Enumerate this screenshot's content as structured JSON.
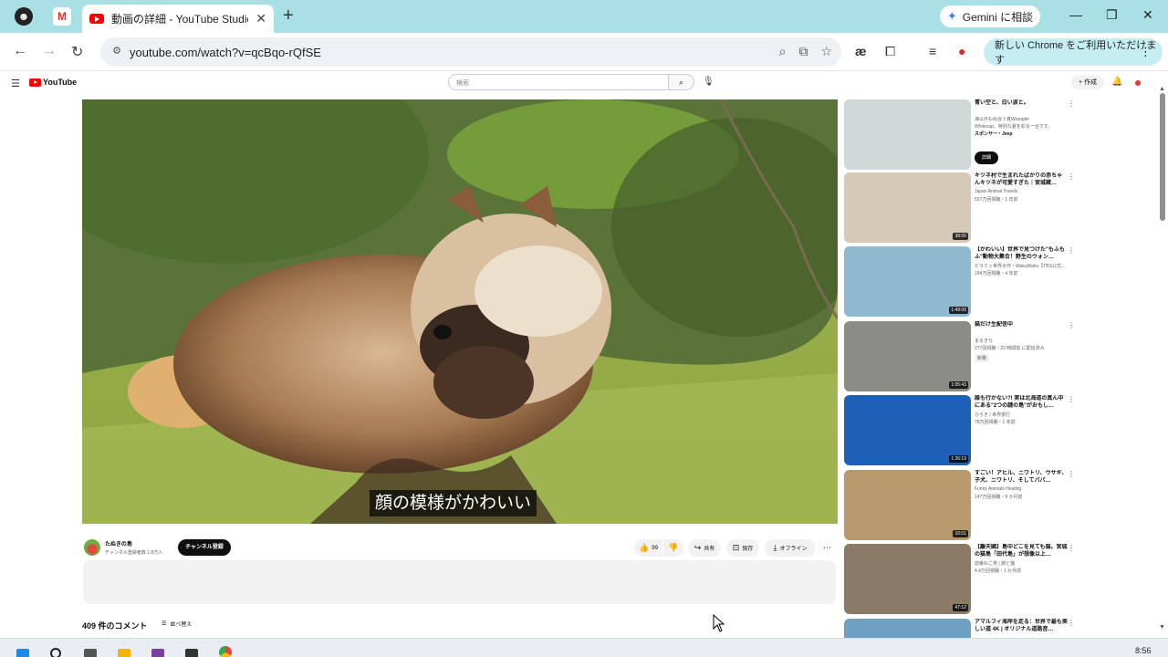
{
  "browser": {
    "tab_title": "動画の詳細 - YouTube Studio",
    "url": "youtube.com/watch?v=qcBqo-rQfSE",
    "gemini_label": "Gemini に相談",
    "update_label": "新しい Chrome をご利用いただけます"
  },
  "yt": {
    "logo": "YouTube",
    "search_placeholder": "検索",
    "create_label": "作成"
  },
  "video": {
    "caption": "顔の模様がかわいい",
    "channel_name": "たぬきの島",
    "channel_subs": "チャンネル登録者数 1.8万人",
    "subscribe": "チャンネル登録",
    "likes": "99",
    "share": "共有",
    "save": "保存",
    "offline": "オフライン"
  },
  "comments": {
    "count": "409 件のコメント",
    "sort": "並べ替え"
  },
  "recommendations": [
    {
      "title": "青い空と、白い波と。",
      "channel": "海以外も似合う真Wrangler",
      "meta": "Whitecap。特別な夏を彩る一台です。",
      "sponsor": "スポンサー・Jeep",
      "duration": "",
      "button": "詳細",
      "bg": "#cfd8d6"
    },
    {
      "title": "キツネ村で生まれたばかりの赤ちゃんキツネが可愛すぎた｜宮城蔵…",
      "channel": "Japan Animal Travels",
      "meta": "557万回視聴・1 年前",
      "duration": "38:05",
      "bg": "#d7c9b8"
    },
    {
      "title": "【かわいい】世界で見つけた\"もふもふ\"動物大集合！野生のウォン…",
      "channel": "ピラミッ世界大作・WakuWaku【TBS公式…",
      "meta": "194万回視聴・4 年前",
      "duration": "1:49:00",
      "bg": "#8fb9cf"
    },
    {
      "title": "猫だけ生配信中",
      "channel": "まるきち",
      "meta": "277回視聴・22 時間前 に配信済み",
      "badge": "新着",
      "duration": "1:05:43",
      "bg": "#8c8c86"
    },
    {
      "title": "誰も行かない?! 実は北海道の真ん中にある\"2つの謎の島\"がおもし…",
      "channel": "ひろき / 世界旅行",
      "meta": "78万回視聴・1 年前",
      "duration": "1:26:19",
      "bg": "#1e5fb8"
    },
    {
      "title": "すごい！アヒル、ニワトリ、ウサギ、子犬、ニワトリ、そしてパパ…",
      "channel": "Funny Animals Healing",
      "meta": "147万回視聴・9 か月前",
      "duration": "10:01",
      "bg": "#b89a6c"
    },
    {
      "title": "【離天國】島中どこを見ても猫。宮城の猫島「田代島」が想像以上…",
      "channel": "前番ねこ男 | 旅と猫",
      "meta": "4.4万回視聴・1 か月前",
      "duration": "47:12",
      "bg": "#8a7a66"
    },
    {
      "title": "アマルフィ海岸を走る：世界で最も美しい道 4K | オリジナル道路音…",
      "channel": "",
      "meta": "",
      "duration": "",
      "bg": "#6f9fc2"
    }
  ],
  "system": {
    "clock": "8:56"
  }
}
